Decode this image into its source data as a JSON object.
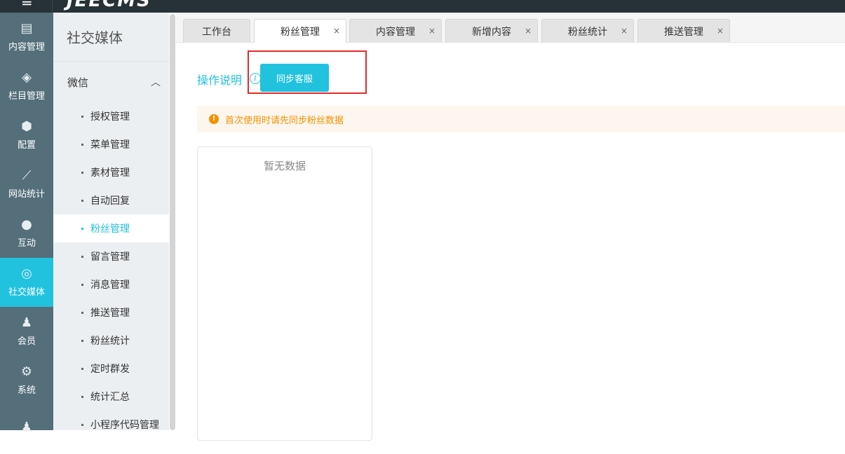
{
  "header": {
    "logo": "JEECMS",
    "menu_icon": "menu-icon"
  },
  "iconbar": [
    {
      "label": "内容管理",
      "icon": "document-icon",
      "glyph": "▤"
    },
    {
      "label": "栏目管理",
      "icon": "layers-icon",
      "glyph": "◈"
    },
    {
      "label": "配置",
      "icon": "cube-icon",
      "glyph": "⬢"
    },
    {
      "label": "网站统计",
      "icon": "line-chart-icon",
      "glyph": "⟋"
    },
    {
      "label": "互动",
      "icon": "chat-icon",
      "glyph": "●"
    },
    {
      "label": "社交媒体",
      "icon": "social-icon",
      "glyph": "◎"
    },
    {
      "label": "会员",
      "icon": "user-icon",
      "glyph": "♟"
    },
    {
      "label": "系统",
      "icon": "gear-icon",
      "glyph": "⚙"
    },
    {
      "label": "",
      "icon": "user-group-icon",
      "glyph": "♟"
    }
  ],
  "subbar": {
    "title": "社交媒体",
    "group": "微信",
    "items": [
      "授权管理",
      "菜单管理",
      "素材管理",
      "自动回复",
      "粉丝管理",
      "留言管理",
      "消息管理",
      "推送管理",
      "粉丝统计",
      "定时群发",
      "统计汇总",
      "小程序代码管理"
    ],
    "active_index": 4
  },
  "tabs": [
    {
      "label": "工作台"
    },
    {
      "label": "粉丝管理"
    },
    {
      "label": "内容管理"
    },
    {
      "label": "新增内容"
    },
    {
      "label": "粉丝统计"
    },
    {
      "label": "推送管理"
    }
  ],
  "main": {
    "help_label": "操作说明",
    "sync_button": "同步客服",
    "notice": "首次使用时请先同步粉丝数据",
    "empty_text": "暂无数据"
  }
}
